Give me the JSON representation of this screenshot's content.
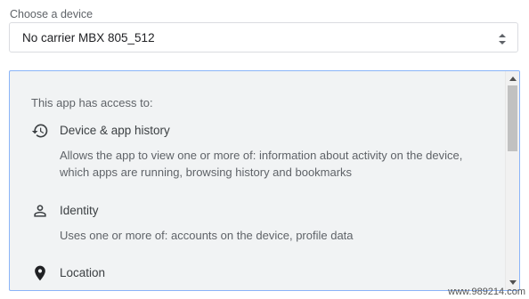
{
  "device_chooser": {
    "label": "Choose a device",
    "selected_value": "No carrier MBX 805_512"
  },
  "permissions": {
    "intro": "This app has access to:",
    "items": [
      {
        "icon": "history-icon",
        "title": "Device & app history",
        "description": "Allows the app to view one or more of: information about activity on the device, which apps are running, browsing history and bookmarks"
      },
      {
        "icon": "person-icon",
        "title": "Identity",
        "description": "Uses one or more of: accounts on the device, profile data"
      },
      {
        "icon": "location-pin-icon",
        "title": "Location",
        "description": ""
      }
    ]
  },
  "scrollbar": {
    "position_fraction": 0.0
  },
  "watermark": "www.989214.com",
  "colors": {
    "panel_background": "#f1f3f4",
    "panel_border": "#8ab4f8",
    "text_primary": "#3c4043",
    "text_secondary": "#5f6368"
  }
}
